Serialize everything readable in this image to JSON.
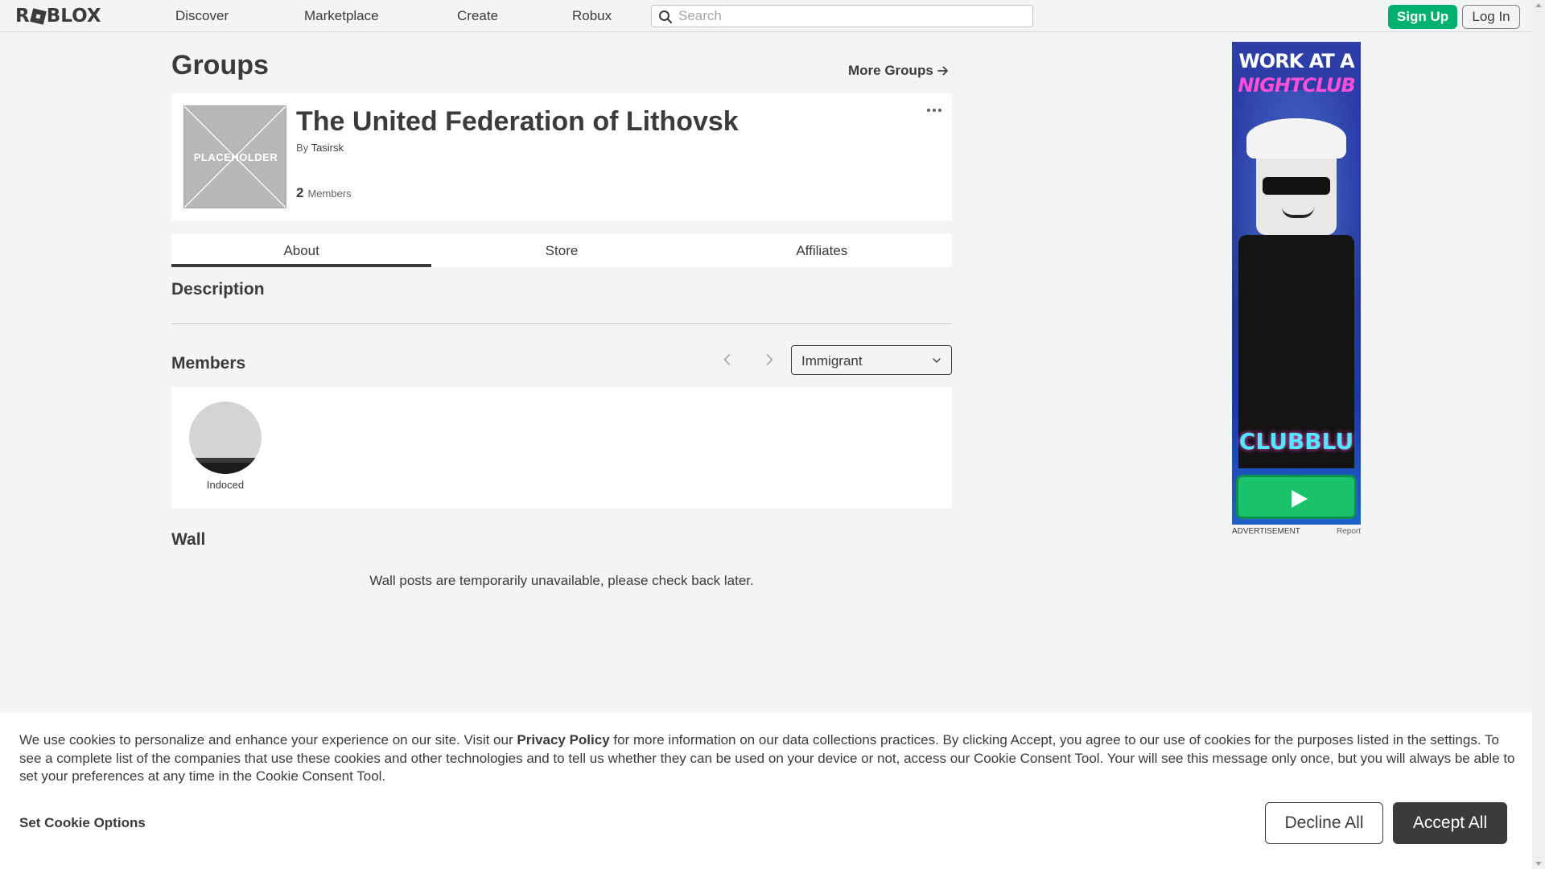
{
  "nav": {
    "logo": "ROBLOX",
    "links": [
      "Discover",
      "Marketplace",
      "Create",
      "Robux"
    ],
    "search_placeholder": "Search",
    "signup_label": "Sign Up",
    "login_label": "Log In"
  },
  "page": {
    "title": "Groups",
    "more_groups": "More Groups"
  },
  "group": {
    "thumb_placeholder": "PLACEHOLDER",
    "name": "The United Federation of Lithovsk",
    "by_prefix": "By",
    "owner": "Tasirsk",
    "member_count": "2",
    "member_label": "Members"
  },
  "tabs": [
    {
      "label": "About",
      "active": true
    },
    {
      "label": "Store",
      "active": false
    },
    {
      "label": "Affiliates",
      "active": false
    }
  ],
  "sections": {
    "description": "Description",
    "members": "Members",
    "wall": "Wall"
  },
  "members": {
    "role_selected": "Immigrant",
    "list": [
      {
        "name": "Indoced"
      }
    ]
  },
  "wall": {
    "message": "Wall posts are temporarily unavailable, please check back later."
  },
  "ad": {
    "headline_1": "WORK AT A",
    "headline_2": "NIGHTCLUB",
    "brand": "CLUBBLU",
    "label": "ADVERTISEMENT",
    "report": "Report"
  },
  "cookie": {
    "text_before": "We use cookies to personalize and enhance your experience on our site. Visit our ",
    "privacy_link": "Privacy Policy",
    "text_after": " for more information on our data collections practices. By clicking Accept, you agree to our use of cookies for the purposes listed in the settings. To see a complete list of the companies that use these cookies and other technologies and to tell us whether they can be used on your device or not, access our Cookie Consent Tool. Your will see this message only once, but you will always be able to set your preferences at any time in the Cookie Consent Tool.",
    "options_label": "Set Cookie Options",
    "decline_label": "Decline All",
    "accept_label": "Accept All"
  },
  "colors": {
    "brand_green": "#00b06f",
    "text_primary": "#393b3d",
    "background": "#f2f4f5"
  }
}
